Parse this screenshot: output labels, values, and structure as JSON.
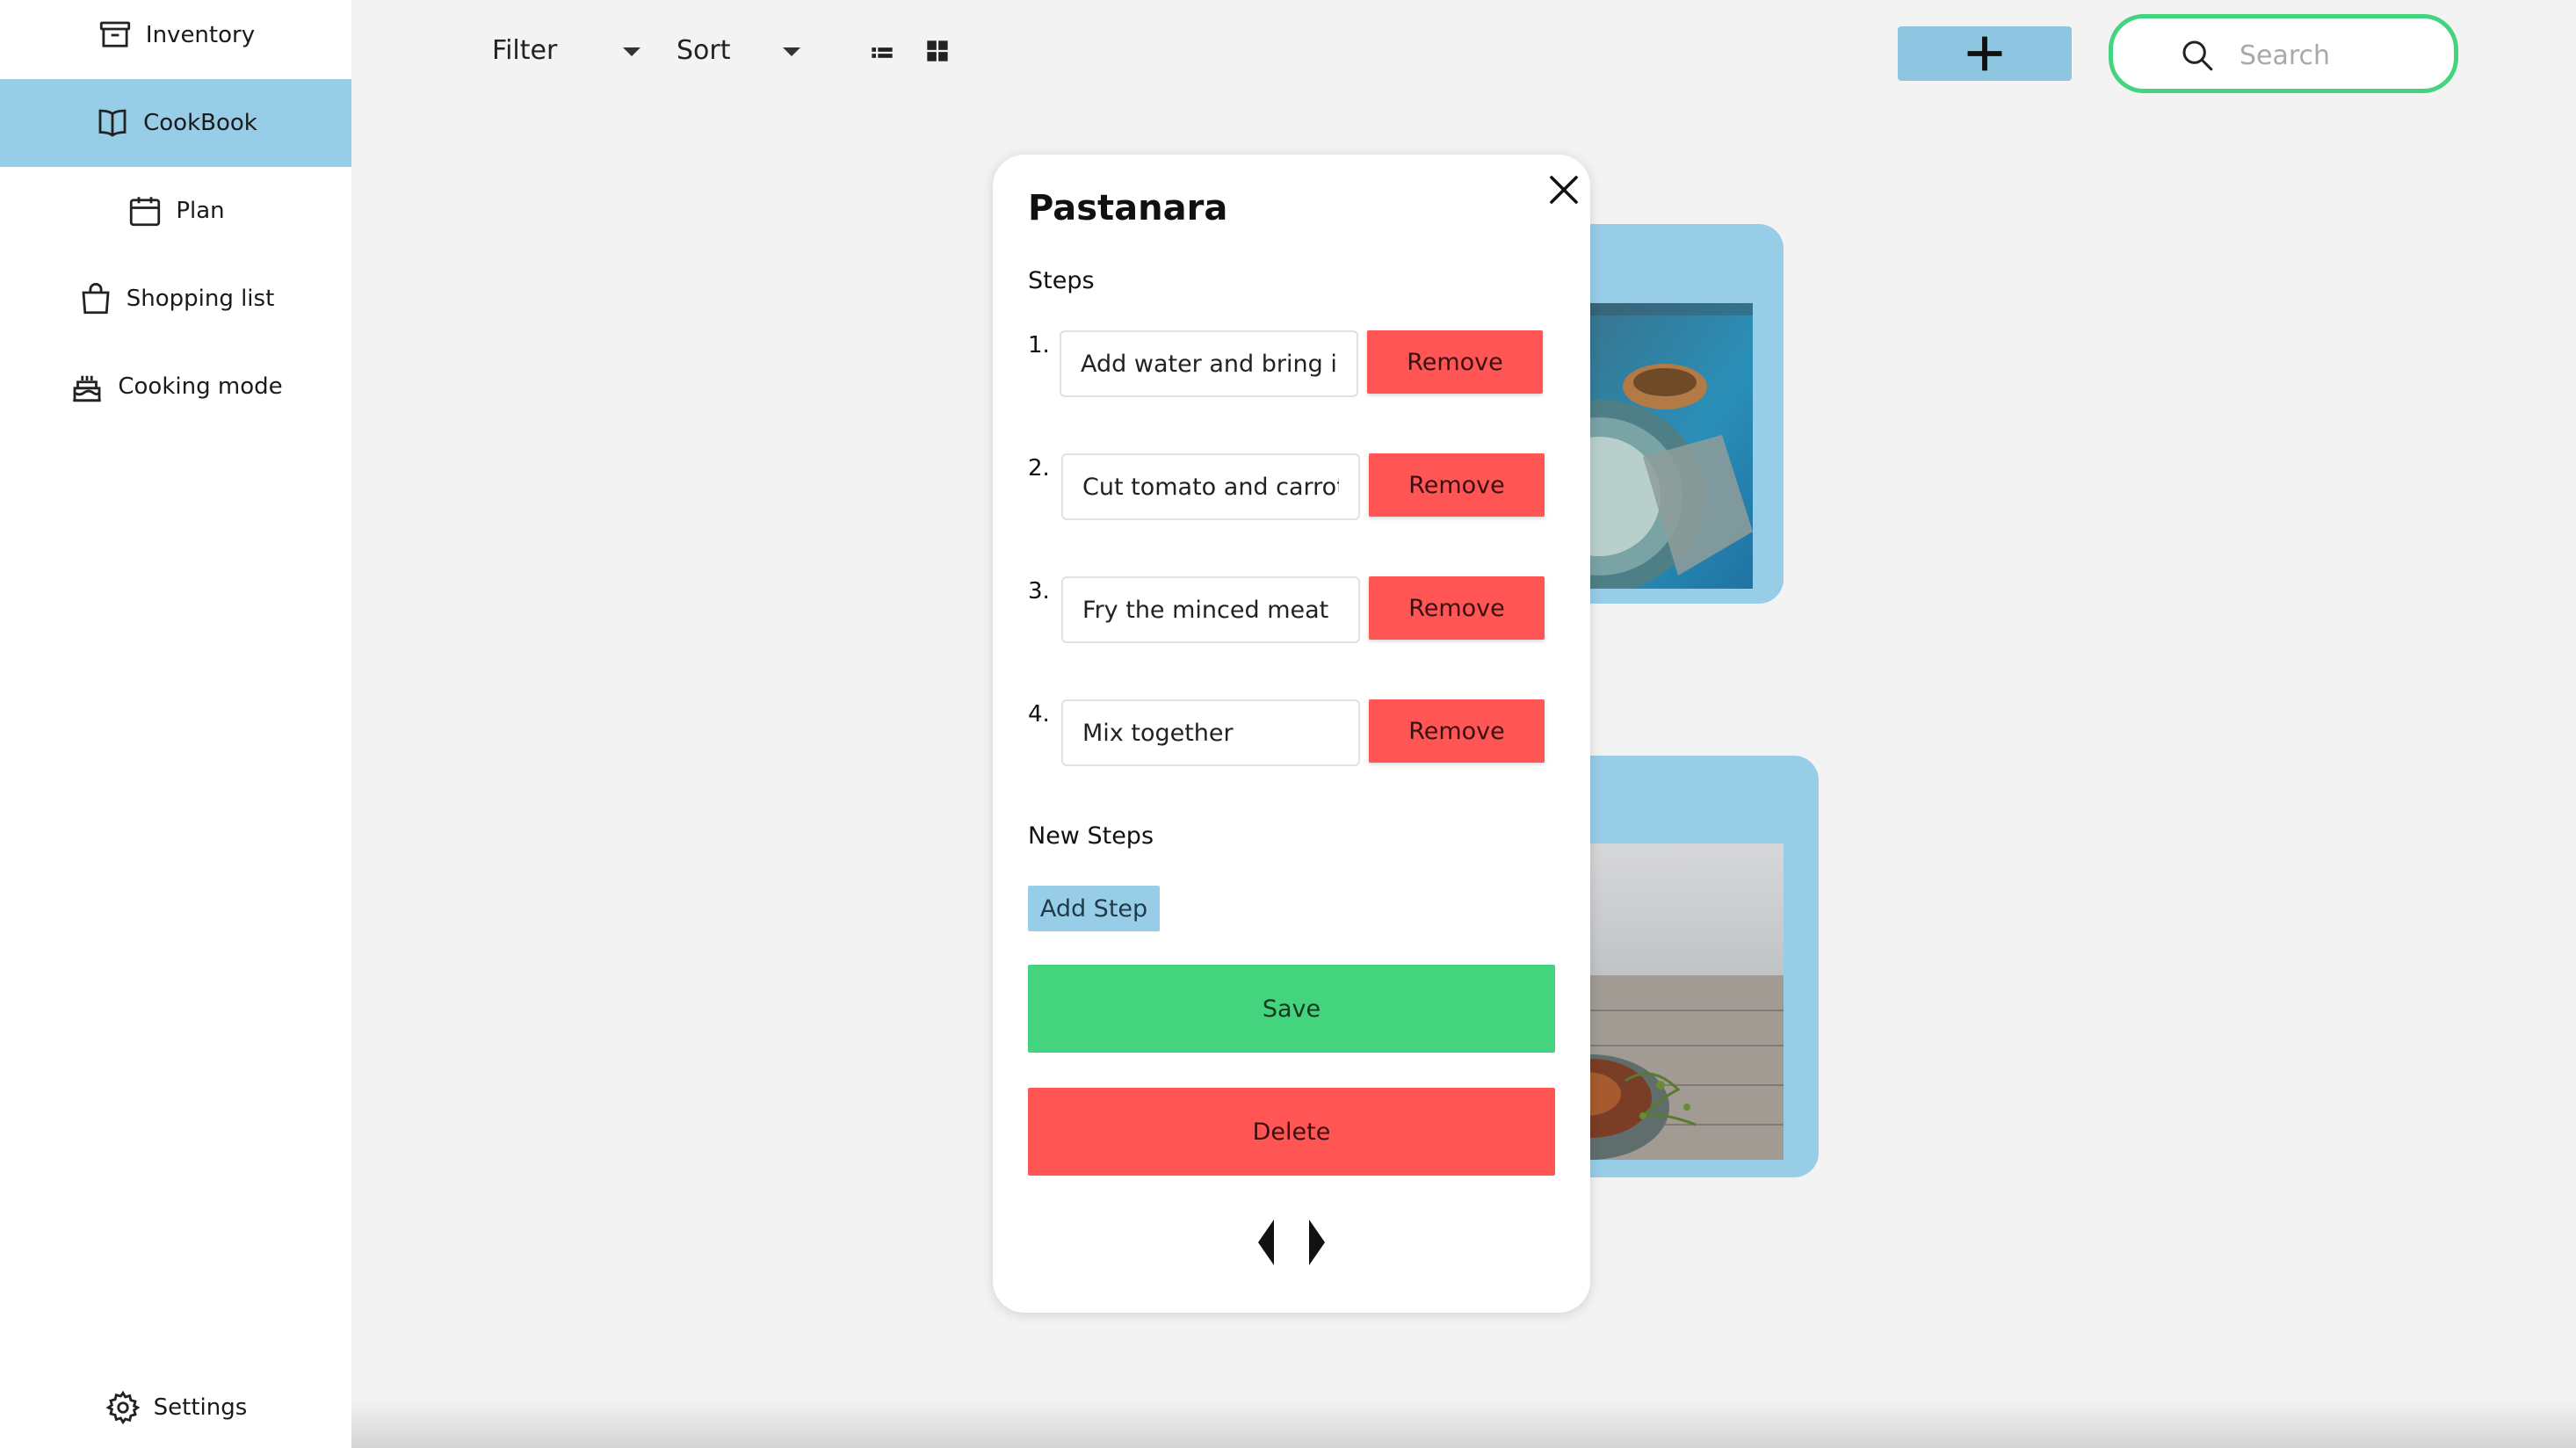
{
  "sidebar": {
    "items": [
      {
        "label": "Inventory",
        "icon": "archive-box-icon"
      },
      {
        "label": "CookBook",
        "icon": "book-open-icon",
        "active": true
      },
      {
        "label": "Plan",
        "icon": "calendar-icon"
      },
      {
        "label": "Shopping list",
        "icon": "shopping-bag-icon"
      },
      {
        "label": "Cooking mode",
        "icon": "cake-icon"
      }
    ],
    "settings": {
      "label": "Settings",
      "icon": "gear-icon"
    },
    "active_color": "#97cde7"
  },
  "toolbar": {
    "filter_label": "Filter",
    "sort_label": "Sort",
    "add_icon": "plus-icon",
    "search_placeholder": "Search",
    "search_border_color": "#44d47e",
    "add_button_color": "#8ec6e2"
  },
  "modal": {
    "title": "Pastanara",
    "steps_heading": "Steps",
    "steps": [
      {
        "number": "1.",
        "text": "Add water and bring it to",
        "remove_label": "Remove"
      },
      {
        "number": "2.",
        "text": "Cut tomato and carrot",
        "remove_label": "Remove"
      },
      {
        "number": "3.",
        "text": "Fry the minced meat",
        "remove_label": "Remove"
      },
      {
        "number": "4.",
        "text": "Mix together",
        "remove_label": "Remove"
      }
    ],
    "new_steps_heading": "New Steps",
    "add_step_label": "Add Step",
    "save_label": "Save",
    "delete_label": "Delete",
    "save_color": "#44d47e",
    "delete_color": "#ff5555"
  }
}
